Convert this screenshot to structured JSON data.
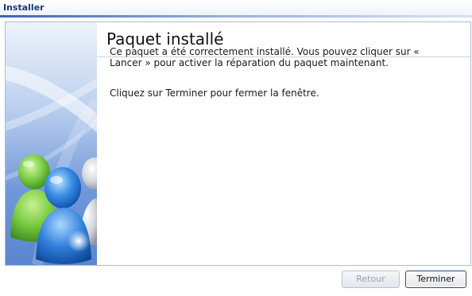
{
  "window": {
    "title": "Installer"
  },
  "page": {
    "heading": "Paquet installé",
    "paragraphs": [
      "Ce paquet a été correctement installé. Vous pouvez cliquer sur « Lancer » pour activer la réparation du paquet maintenant.",
      "Cliquez sur Terminer pour fermer la fenêtre."
    ]
  },
  "buttons": {
    "back": {
      "label": "Retour",
      "enabled": false
    },
    "finish": {
      "label": "Terminer",
      "enabled": true
    }
  },
  "banner": {
    "icon": "users-icon"
  }
}
